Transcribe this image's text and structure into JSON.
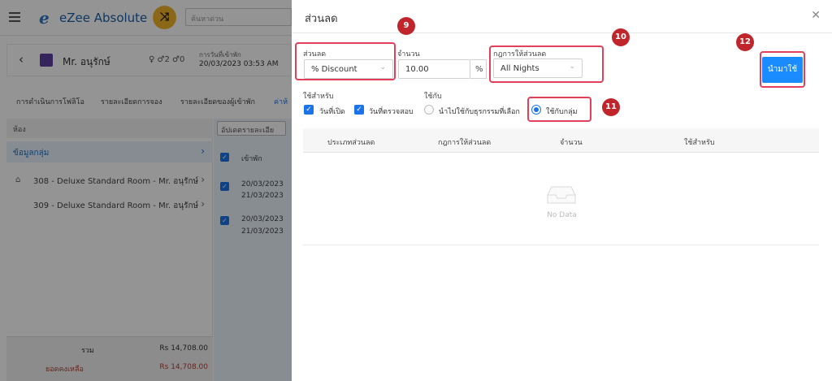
{
  "app": {
    "logo_mark": "e",
    "logo_text": "eZee Absolute",
    "search_placeholder": "ค้นหาด่วน"
  },
  "guest": {
    "name": "Mr. อนุรักษ์",
    "meta": "♀ ♂2 ♂0",
    "arrival_label": "การวันที่เข้าพัก",
    "arrival_value": "20/03/2023 03:53 AM"
  },
  "tabs": [
    "การดำเนินการโฟลิโอ",
    "รายละเอียดการจอง",
    "รายละเอียดของผู้เข้าพัก",
    "ค่าห้"
  ],
  "rooms": {
    "header": "ห้อง",
    "group_label": "ข้อมูลกลุ่ม",
    "items": [
      "308 - Deluxe Standard Room - Mr. อนุรักษ์",
      "309 - Deluxe Standard Room - Mr. อนุรักษ์"
    ],
    "total_label": "รวม",
    "total_value": "Rs 14,708.00",
    "balance_label": "ยอดคงเหลือ",
    "balance_value": "Rs 14,708.00"
  },
  "side": {
    "update_btn": "อัปเดตรายละเอีย",
    "col_label": "เข้าพัก",
    "rows": [
      {
        "d1": "20/03/2023",
        "d2": "21/03/2023"
      },
      {
        "d1": "20/03/2023",
        "d2": "21/03/2023"
      }
    ]
  },
  "drawer": {
    "title": "ส่วนลด",
    "discount_label": "ส่วนลด",
    "discount_value": "% Discount",
    "amount_label": "จำนวน",
    "amount_value": "10.00",
    "amount_unit": "%",
    "rule_label": "กฎการให้ส่วนลด",
    "rule_value": "All Nights",
    "apply_button": "นำมาใช้",
    "apply_for_label": "ใช้สำหรับ",
    "apply_for_options": [
      "วันที่เปิด",
      "วันที่ตรวจสอบ"
    ],
    "apply_to_label": "ใช้กับ",
    "apply_to_options": [
      "นำไปใช้กับธุรกรรมที่เลือก",
      "ใช้กับกลุ่ม"
    ],
    "table_headers": [
      "ประเภทส่วนลด",
      "กฎการให้ส่วนลด",
      "จำนวน",
      "ใช้สำหรับ"
    ],
    "no_data": "No Data"
  },
  "badges": [
    "9",
    "10",
    "11",
    "12"
  ],
  "colors": {
    "accent": "#1a8cff",
    "highlight": "#e0405a",
    "badge": "#c0252c"
  }
}
